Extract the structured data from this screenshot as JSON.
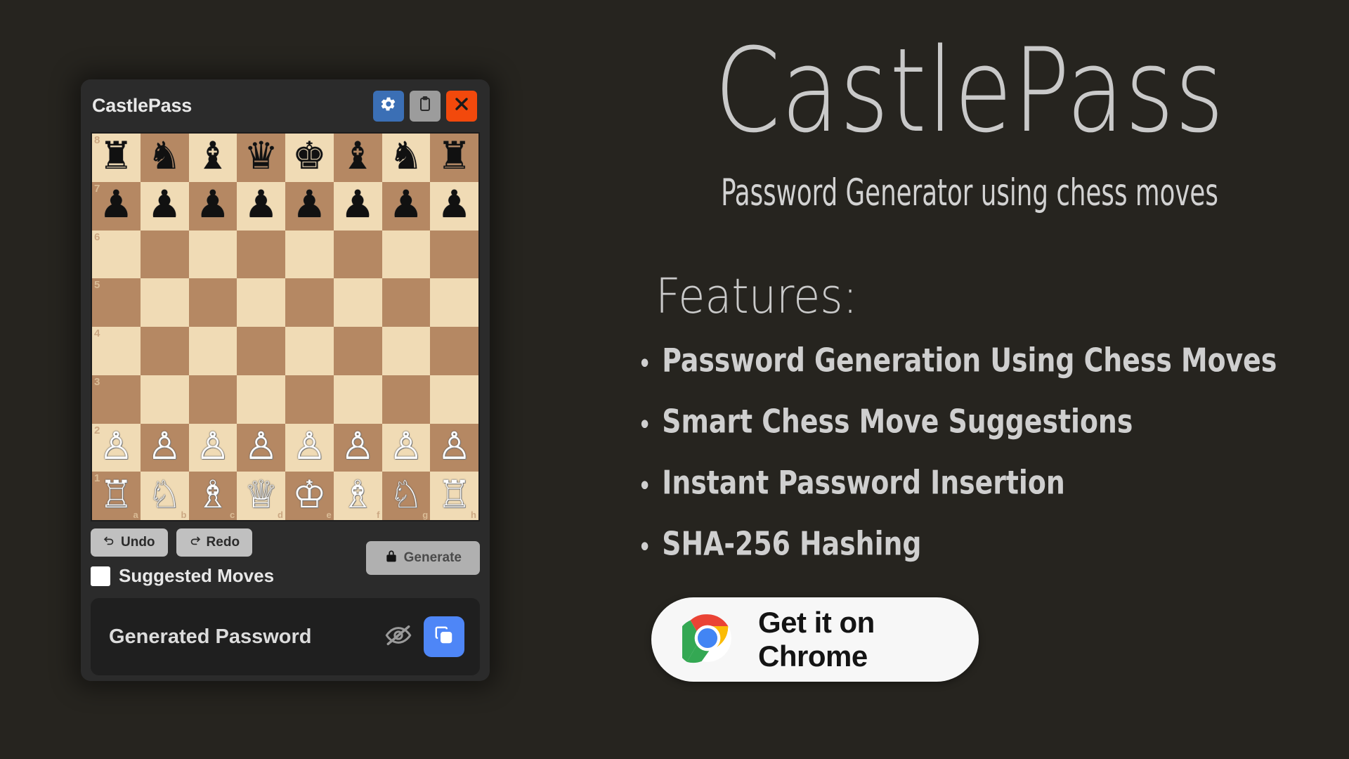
{
  "theme": {
    "page_background": "#26241f",
    "panel_background": "#2b2b2b",
    "board_light": "#f0dbb5",
    "board_dark": "#b58863",
    "accent_blue": "#3b6fb5",
    "copy_blue": "#4e86f7",
    "close_red": "#f2490c"
  },
  "popup": {
    "title": "CastlePass",
    "titlebar_buttons": [
      {
        "name": "settings-button",
        "icon": "gear-icon",
        "color": "#3b6fb5"
      },
      {
        "name": "clipboard-button",
        "icon": "clipboard-icon",
        "color": "#9c9c9c"
      },
      {
        "name": "close-button",
        "icon": "close-icon",
        "color": "#f2490c"
      }
    ],
    "board": {
      "ranks": [
        "8",
        "7",
        "6",
        "5",
        "4",
        "3",
        "2",
        "1"
      ],
      "files": [
        "a",
        "b",
        "c",
        "d",
        "e",
        "f",
        "g",
        "h"
      ],
      "position_rows": [
        [
          "r",
          "n",
          "b",
          "q",
          "k",
          "b",
          "n",
          "r"
        ],
        [
          "p",
          "p",
          "p",
          "p",
          "p",
          "p",
          "p",
          "p"
        ],
        [
          "",
          "",
          "",
          "",
          "",
          "",
          "",
          ""
        ],
        [
          "",
          "",
          "",
          "",
          "",
          "",
          "",
          ""
        ],
        [
          "",
          "",
          "",
          "",
          "",
          "",
          "",
          ""
        ],
        [
          "",
          "",
          "",
          "",
          "",
          "",
          "",
          ""
        ],
        [
          "P",
          "P",
          "P",
          "P",
          "P",
          "P",
          "P",
          "P"
        ],
        [
          "R",
          "N",
          "B",
          "Q",
          "K",
          "B",
          "N",
          "R"
        ]
      ]
    },
    "controls": {
      "undo_label": "Undo",
      "redo_label": "Redo",
      "generate_label": "Generate",
      "suggested_moves_label": "Suggested Moves",
      "suggested_moves_checked": false
    },
    "password": {
      "placeholder": "Generated Password",
      "value": "",
      "visibility_state": "hidden"
    }
  },
  "marketing": {
    "brand_title": "CastlePass",
    "subtitle": "Password Generator using chess moves",
    "features_heading": "Features:",
    "features": [
      "Password Generation Using Chess Moves",
      "Smart Chess Move Suggestions",
      "Instant Password Insertion",
      "SHA-256 Hashing"
    ],
    "cta_label": "Get it on Chrome"
  }
}
